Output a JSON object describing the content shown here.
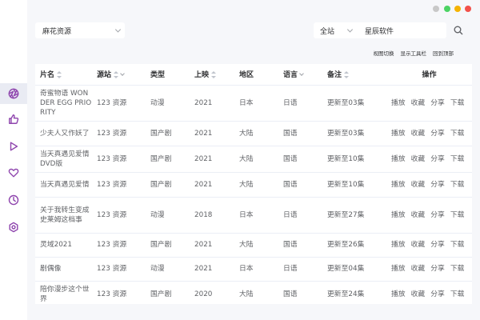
{
  "window": {
    "controls": [
      "minimize-gray",
      "restore-green",
      "maximize-yellow",
      "close-red"
    ]
  },
  "sidebar": {
    "items": [
      {
        "icon": "aperture-icon",
        "active": true
      },
      {
        "icon": "thumbs-up-icon",
        "active": false
      },
      {
        "icon": "play-icon",
        "active": false
      },
      {
        "icon": "heart-icon",
        "active": false
      },
      {
        "icon": "clock-icon",
        "active": false
      },
      {
        "icon": "settings-icon",
        "active": false
      }
    ]
  },
  "header": {
    "source_select": "麻花资源",
    "scope_select": "全站",
    "search_value": "星辰软件"
  },
  "toolbar": {
    "view_switch": "视图切换",
    "show_toolbar": "显示工具栏",
    "back_to_top": "回到顶部"
  },
  "table": {
    "columns": [
      "片名",
      "源站",
      "类型",
      "上映",
      "地区",
      "语言",
      "备注",
      "操作"
    ],
    "actions": [
      "播放",
      "收藏",
      "分享",
      "下载"
    ],
    "rows": [
      {
        "title": "奇蜜物语 WONDER EGG PRIORITY",
        "site": "123 资源",
        "type": "动漫",
        "year": "2021",
        "region": "日本",
        "lang": "日语",
        "note": "更新至03集"
      },
      {
        "title": "少夫人又作妖了",
        "site": "123 资源",
        "type": "国产剧",
        "year": "2021",
        "region": "大陆",
        "lang": "国语",
        "note": "更新至03集"
      },
      {
        "title": "当天真遇见爱情DVD版",
        "site": "123 资源",
        "type": "国产剧",
        "year": "2021",
        "region": "大陆",
        "lang": "国语",
        "note": "更新至10集"
      },
      {
        "title": "当天真遇见爱情",
        "site": "123 资源",
        "type": "国产剧",
        "year": "2021",
        "region": "大陆",
        "lang": "国语",
        "note": "更新至10集"
      },
      {
        "title": "关于我转生变成史莱姆这档事",
        "site": "123 资源",
        "type": "动漫",
        "year": "2018",
        "region": "日本",
        "lang": "日语",
        "note": "更新至27集"
      },
      {
        "title": "灵域2021",
        "site": "123 资源",
        "type": "国产剧",
        "year": "2021",
        "region": "大陆",
        "lang": "国语",
        "note": "更新至26集"
      },
      {
        "title": "剧偶像",
        "site": "123 资源",
        "type": "动漫",
        "year": "2021",
        "region": "日本",
        "lang": "日语",
        "note": "更新至04集"
      },
      {
        "title": "陪你漫步这个世界",
        "site": "123 资源",
        "type": "国产剧",
        "year": "2020",
        "region": "大陆",
        "lang": "国语",
        "note": "更新至24集"
      }
    ]
  }
}
